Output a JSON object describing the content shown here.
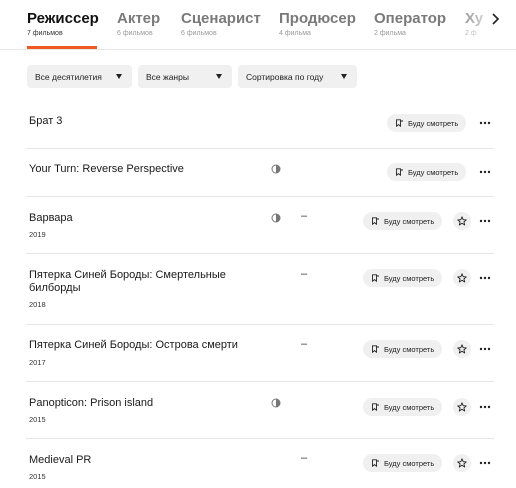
{
  "tabs": [
    {
      "label": "Режиссер",
      "count": "7 фильмов",
      "active": true
    },
    {
      "label": "Актер",
      "count": "6 фильмов"
    },
    {
      "label": "Сценарист",
      "count": "6 фильмов"
    },
    {
      "label": "Продюсер",
      "count": "4 фильма"
    },
    {
      "label": "Оператор",
      "count": "2 фильма"
    },
    {
      "label": "Ху",
      "count": "2 ф"
    }
  ],
  "filters": {
    "decades": "Все десятилетия",
    "genres": "Все жанры",
    "sort": "Сортировка по году"
  },
  "watch_label": "Буду смотреть",
  "films": [
    {
      "title": "Брат 3",
      "year": ""
    },
    {
      "title": "Your Turn: Reverse Perspective",
      "year": ""
    },
    {
      "title": "Варвара",
      "year": "2019",
      "dash": "–"
    },
    {
      "title": "Пятерка Синей Бороды: Смертельные билборды",
      "year": "2018",
      "dash": "–"
    },
    {
      "title": "Пятерка Синей Бороды: Острова смерти",
      "year": "2017",
      "dash": "–"
    },
    {
      "title": "Panopticon: Prison island",
      "year": "2015",
      "dash": ""
    },
    {
      "title": "Medieval PR",
      "year": "2015",
      "dash": "–"
    }
  ],
  "colors": {
    "accent": "#f05a22",
    "chip_bg": "#f0f0f0"
  },
  "icons": [
    "bookmark-icon",
    "star-icon",
    "more-icon",
    "rating-half-icon",
    "chevron-right-icon"
  ]
}
